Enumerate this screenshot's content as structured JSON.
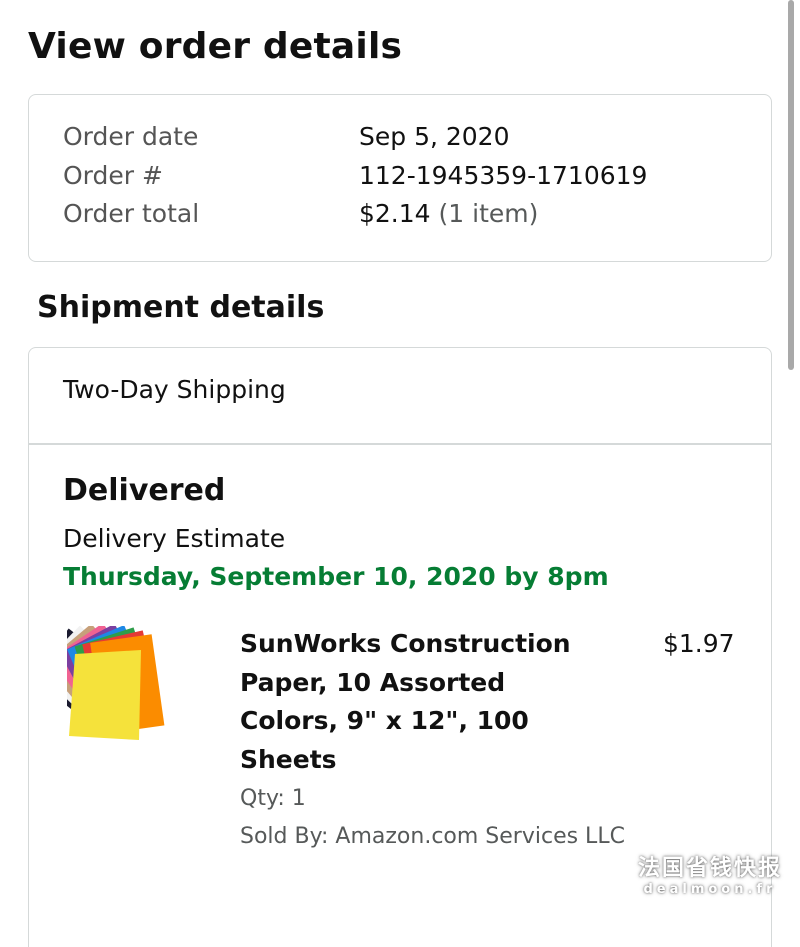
{
  "page": {
    "title": "View order details"
  },
  "order_summary": {
    "rows": [
      {
        "label": "Order date",
        "value": "Sep 5, 2020"
      },
      {
        "label": "Order #",
        "value": "112-1945359-1710619"
      },
      {
        "label": "Order total",
        "value": "$2.14",
        "note": "(1 item)"
      }
    ]
  },
  "shipment": {
    "section_title": "Shipment details",
    "method": "Two-Day Shipping",
    "status": "Delivered",
    "estimate_label": "Delivery Estimate",
    "estimate_date": "Thursday, September 10, 2020 by 8pm",
    "item": {
      "title": "SunWorks Construction Paper, 10 Assorted Colors, 9\" x 12\", 100 Sheets",
      "price": "$1.97",
      "qty": "Qty: 1",
      "seller": "Sold By: Amazon.com Services LLC",
      "image_icon": "construction-paper-stack"
    }
  },
  "watermark": {
    "line1": "法国省钱快报",
    "line2": "dealmoon.fr"
  },
  "colors": {
    "estimate_green": "#067d34",
    "border": "#d5d9d9",
    "muted_text": "#565959",
    "scrollbar": "#a9a9a9"
  }
}
